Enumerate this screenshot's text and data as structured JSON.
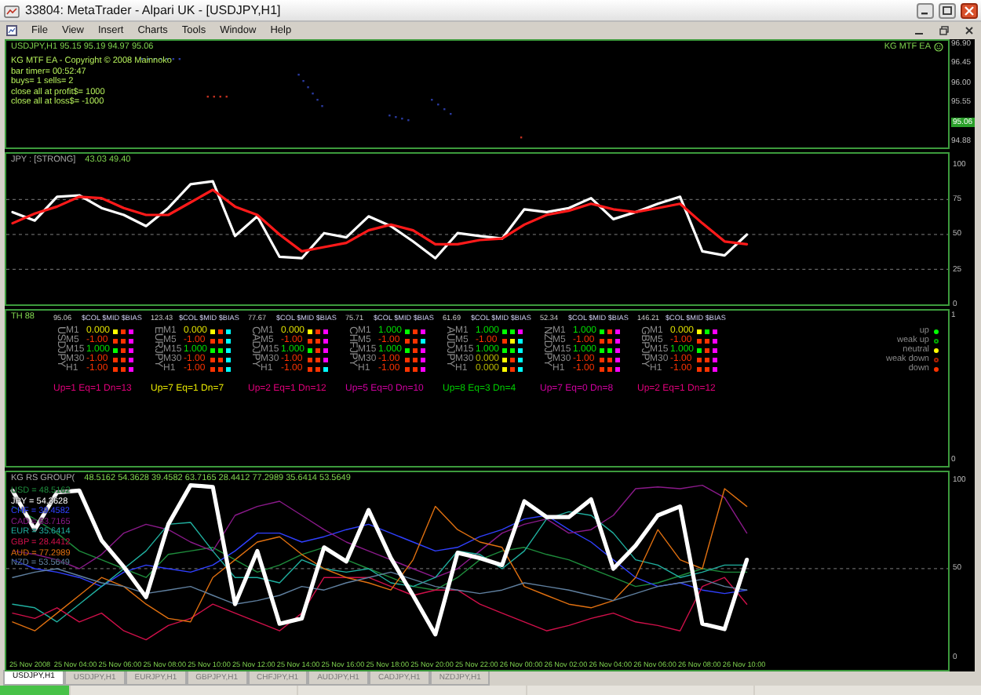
{
  "window": {
    "title": "33804: MetaTrader - Alpari UK - [USDJPY,H1]"
  },
  "menu": [
    "File",
    "View",
    "Insert",
    "Charts",
    "Tools",
    "Window",
    "Help"
  ],
  "price_pane": {
    "symbol_line": "USDJPY,H1  95.15 95.19 94.97 95.06",
    "expert": "KG MTF EA",
    "info_lines": [
      "KG MTF EA - Copyright © 2008 Mainnoko",
      "bar timer= 00:52:47",
      "buys= 1    sells= 2",
      "close all at profit$= 1000",
      "close all at loss$= -1000"
    ],
    "axis_labels": [
      {
        "text": "96.90",
        "current": false
      },
      {
        "text": "96.45",
        "current": false
      },
      {
        "text": "96.00",
        "current": false
      },
      {
        "text": "95.55",
        "current": false
      },
      {
        "text": "95.06",
        "current": true
      },
      {
        "text": "94.88",
        "current": false
      }
    ]
  },
  "strength_pane": {
    "title": "JPY : [STRONG]",
    "values": "43.03 49.40",
    "chart_data": {
      "type": "line",
      "ylim": [
        0,
        107.8
      ],
      "yticks": [
        0,
        25,
        50,
        75,
        100
      ],
      "grid": true,
      "series": [
        {
          "color": "#ffffff",
          "values": [
            66,
            60,
            77,
            78,
            69,
            64,
            56,
            69,
            86,
            88,
            49,
            63,
            34,
            33,
            51,
            48,
            63,
            56,
            45,
            33,
            51,
            49,
            47,
            68,
            66,
            69,
            76,
            61,
            66,
            72,
            77,
            38,
            35,
            50
          ]
        },
        {
          "color": "#ff1a1a",
          "values": [
            58,
            65,
            70,
            77,
            76,
            69,
            64,
            64,
            73,
            82,
            70,
            64,
            50,
            38,
            41,
            44,
            53,
            57,
            53,
            43,
            43,
            46,
            47,
            57,
            64,
            67,
            72,
            68,
            66,
            69,
            72,
            58,
            45,
            43
          ]
        }
      ]
    }
  },
  "matrix_pane": {
    "title": "TH 88",
    "axis_labels": [
      "1",
      "0"
    ],
    "pairs": [
      {
        "name": "USDJPY",
        "price": "95.06",
        "header": "$COL $MID $BIAS",
        "summary": "Up=1 Eq=1 Dn=13",
        "color": "#e0007a",
        "rows": [
          {
            "tf": "M1",
            "value": "0.000",
            "color": "#e0e000",
            "dots": [
              {
                "color": "#ffff00"
              },
              {
                "color": "#ff3300"
              },
              {
                "color": "#ff00ff"
              }
            ]
          },
          {
            "tf": "M5",
            "value": "-1.00",
            "color": "#ff3300",
            "dots": [
              {
                "color": "#ff3300"
              },
              {
                "color": "#ff3300"
              },
              {
                "color": "#ff00ff"
              }
            ]
          },
          {
            "tf": "M15",
            "value": "1.000",
            "color": "#00e000",
            "dots": [
              {
                "color": "#00ff00"
              },
              {
                "color": "#ff3300"
              },
              {
                "color": "#ff00ff"
              }
            ]
          },
          {
            "tf": "M30",
            "value": "-1.00",
            "color": "#ff3300",
            "dots": [
              {
                "color": "#ff3300"
              },
              {
                "color": "#ff3300"
              },
              {
                "color": "#ff00ff"
              }
            ]
          },
          {
            "tf": "H1",
            "value": "-1.00",
            "color": "#ff3300",
            "dots": [
              {
                "color": "#ff3300"
              },
              {
                "color": "#ff3300"
              },
              {
                "color": "#ff00ff"
              }
            ]
          }
        ]
      },
      {
        "name": "EURJPY",
        "price": "123.43",
        "header": "$COL $MID $BIAS",
        "summary": "Up=7 Eq=1 Dn=7",
        "color": "#e8e800",
        "rows": [
          {
            "tf": "M1",
            "value": "0.000",
            "color": "#e0e000",
            "dots": [
              {
                "color": "#ffff00"
              },
              {
                "color": "#ff3300"
              },
              {
                "color": "#00ffff"
              }
            ]
          },
          {
            "tf": "M5",
            "value": "-1.00",
            "color": "#ff3300",
            "dots": [
              {
                "color": "#ff3300"
              },
              {
                "color": "#ff3300"
              },
              {
                "color": "#00ffff"
              }
            ]
          },
          {
            "tf": "M15",
            "value": "1.000",
            "color": "#00e000",
            "dots": [
              {
                "color": "#00ff00"
              },
              {
                "color": "#00ff00"
              },
              {
                "color": "#00ffff"
              }
            ]
          },
          {
            "tf": "M30",
            "value": "-1.00",
            "color": "#ff3300",
            "dots": [
              {
                "color": "#ff3300"
              },
              {
                "color": "#ff3300"
              },
              {
                "color": "#00ffff"
              }
            ]
          },
          {
            "tf": "H1",
            "value": "-1.00",
            "color": "#ff3300",
            "dots": [
              {
                "color": "#ff3300"
              },
              {
                "color": "#ff3300"
              },
              {
                "color": "#00ffff"
              }
            ]
          }
        ]
      },
      {
        "name": "CADJPY",
        "price": "77.67",
        "header": "$COL $MID $BIAS",
        "summary": "Up=2 Eq=1 Dn=12",
        "color": "#e0007a",
        "rows": [
          {
            "tf": "M1",
            "value": "0.000",
            "color": "#e0e000",
            "dots": [
              {
                "color": "#ffff00"
              },
              {
                "color": "#ff3300"
              },
              {
                "color": "#ff00ff"
              }
            ]
          },
          {
            "tf": "M5",
            "value": "-1.00",
            "color": "#ff3300",
            "dots": [
              {
                "color": "#ff3300"
              },
              {
                "color": "#ff3300"
              },
              {
                "color": "#ff00ff"
              }
            ]
          },
          {
            "tf": "M15",
            "value": "1.000",
            "color": "#00e000",
            "dots": [
              {
                "color": "#00ff00"
              },
              {
                "color": "#ff3300"
              },
              {
                "color": "#ff00ff"
              }
            ]
          },
          {
            "tf": "M30",
            "value": "-1.00",
            "color": "#ff3300",
            "dots": [
              {
                "color": "#ff3300"
              },
              {
                "color": "#ff3300"
              },
              {
                "color": "#ff00ff"
              }
            ]
          },
          {
            "tf": "H1",
            "value": "-1.00",
            "color": "#ff3300",
            "dots": [
              {
                "color": "#ff3300"
              },
              {
                "color": "#ff3300"
              },
              {
                "color": "#00ffff"
              }
            ]
          }
        ]
      },
      {
        "name": "CHFJPY",
        "price": "75.71",
        "header": "$COL $MID $BIAS",
        "summary": "Up=5 Eq=0 Dn=10",
        "color": "#d000a0",
        "rows": [
          {
            "tf": "M1",
            "value": "1.000",
            "color": "#00e000",
            "dots": [
              {
                "color": "#00ff00"
              },
              {
                "color": "#ff3300"
              },
              {
                "color": "#ff00ff"
              }
            ]
          },
          {
            "tf": "M5",
            "value": "-1.00",
            "color": "#ff3300",
            "dots": [
              {
                "color": "#ff3300"
              },
              {
                "color": "#ff3300"
              },
              {
                "color": "#00ffff"
              }
            ]
          },
          {
            "tf": "M15",
            "value": "1.000",
            "color": "#00e000",
            "dots": [
              {
                "color": "#00ff00"
              },
              {
                "color": "#ff3300"
              },
              {
                "color": "#ff00ff"
              }
            ]
          },
          {
            "tf": "M30",
            "value": "-1.00",
            "color": "#ff3300",
            "dots": [
              {
                "color": "#ff3300"
              },
              {
                "color": "#ff3300"
              },
              {
                "color": "#ff00ff"
              }
            ]
          },
          {
            "tf": "H1",
            "value": "-1.00",
            "color": "#ff3300",
            "dots": [
              {
                "color": "#ff3300"
              },
              {
                "color": "#ff3300"
              },
              {
                "color": "#ff00ff"
              }
            ]
          }
        ]
      },
      {
        "name": "AUDJPY",
        "price": "61.69",
        "header": "$COL $MID $BIAS",
        "summary": "Up=8 Eq=3 Dn=4",
        "color": "#00cc00",
        "rows": [
          {
            "tf": "M1",
            "value": "1.000",
            "color": "#00e000",
            "dots": [
              {
                "color": "#00ff00"
              },
              {
                "color": "#00ff00"
              },
              {
                "color": "#ff00ff"
              }
            ]
          },
          {
            "tf": "M5",
            "value": "-1.00",
            "color": "#ff3300",
            "dots": [
              {
                "color": "#ff3300"
              },
              {
                "color": "#ffff00"
              },
              {
                "color": "#00ffff"
              }
            ]
          },
          {
            "tf": "M15",
            "value": "1.000",
            "color": "#00e000",
            "dots": [
              {
                "color": "#00ff00"
              },
              {
                "color": "#00ff00"
              },
              {
                "color": "#00ffff"
              }
            ]
          },
          {
            "tf": "M30",
            "value": "0.000",
            "color": "#b8b800",
            "dots": [
              {
                "color": "#ffff00"
              },
              {
                "color": "#ff3300"
              },
              {
                "color": "#00ffff"
              }
            ]
          },
          {
            "tf": "H1",
            "value": "0.000",
            "color": "#b8b800",
            "dots": [
              {
                "color": "#ffff00"
              },
              {
                "color": "#ff3300"
              },
              {
                "color": "#00ffff"
              }
            ]
          }
        ]
      },
      {
        "name": "NZDJPY",
        "price": "52.34",
        "header": "$COL $MID $BIAS",
        "summary": "Up=7 Eq=0 Dn=8",
        "color": "#d000a0",
        "rows": [
          {
            "tf": "M1",
            "value": "1.000",
            "color": "#00e000",
            "dots": [
              {
                "color": "#00ff00"
              },
              {
                "color": "#ff3300"
              },
              {
                "color": "#ff00ff"
              }
            ]
          },
          {
            "tf": "M5",
            "value": "-1.00",
            "color": "#ff3300",
            "dots": [
              {
                "color": "#ff3300"
              },
              {
                "color": "#ff3300"
              },
              {
                "color": "#ff00ff"
              }
            ]
          },
          {
            "tf": "M15",
            "value": "1.000",
            "color": "#00e000",
            "dots": [
              {
                "color": "#00ff00"
              },
              {
                "color": "#00ff00"
              },
              {
                "color": "#ff00ff"
              }
            ]
          },
          {
            "tf": "M30",
            "value": "-1.00",
            "color": "#ff3300",
            "dots": [
              {
                "color": "#ff3300"
              },
              {
                "color": "#ff3300"
              },
              {
                "color": "#ff00ff"
              }
            ]
          },
          {
            "tf": "H1",
            "value": "-1.00",
            "color": "#ff3300",
            "dots": [
              {
                "color": "#ff3300"
              },
              {
                "color": "#ff3300"
              },
              {
                "color": "#ff00ff"
              }
            ]
          }
        ]
      },
      {
        "name": "GBPJPY",
        "price": "146.21",
        "header": "$COL $MID $BIAS",
        "summary": "Up=2 Eq=1 Dn=12",
        "color": "#e0007a",
        "rows": [
          {
            "tf": "M1",
            "value": "0.000",
            "color": "#e0e000",
            "dots": [
              {
                "color": "#ffff00"
              },
              {
                "color": "#00ff00"
              },
              {
                "color": "#ff00ff"
              }
            ]
          },
          {
            "tf": "M5",
            "value": "-1.00",
            "color": "#ff3300",
            "dots": [
              {
                "color": "#ff3300"
              },
              {
                "color": "#ff3300"
              },
              {
                "color": "#ff00ff"
              }
            ]
          },
          {
            "tf": "M15",
            "value": "1.000",
            "color": "#00e000",
            "dots": [
              {
                "color": "#00ff00"
              },
              {
                "color": "#ff3300"
              },
              {
                "color": "#ff00ff"
              }
            ]
          },
          {
            "tf": "M30",
            "value": "-1.00",
            "color": "#ff3300",
            "dots": [
              {
                "color": "#ff3300"
              },
              {
                "color": "#ff3300"
              },
              {
                "color": "#ff00ff"
              }
            ]
          },
          {
            "tf": "H1",
            "value": "-1.00",
            "color": "#ff3300",
            "dots": [
              {
                "color": "#ff3300"
              },
              {
                "color": "#ff3300"
              },
              {
                "color": "#ff00ff"
              }
            ]
          }
        ]
      }
    ],
    "legend": [
      {
        "label": "up",
        "kind": "solid",
        "color": "#00ff00"
      },
      {
        "label": "weak up",
        "kind": "hollow",
        "color": "#00aa00"
      },
      {
        "label": "neutral",
        "kind": "solid",
        "color": "#ffff00"
      },
      {
        "label": "weak down",
        "kind": "hollow",
        "color": "#b02000"
      },
      {
        "label": "down",
        "kind": "solid",
        "color": "#ff3300"
      }
    ]
  },
  "rs_pane": {
    "title": "KG RS GROUP(",
    "values": "48.5162 54.3628 39.4582 63.7165 28.4412 77.2989 35.6414 53.5649",
    "legend": [
      {
        "label": "USD = 48.5162",
        "color": "#1e8c3c"
      },
      {
        "label": "JPY = 54.3628",
        "color": "#ffffff"
      },
      {
        "label": "CHF = 39.4582",
        "color": "#3040ff"
      },
      {
        "label": "CAD = 63.7165",
        "color": "#8a1a8a"
      },
      {
        "label": "EUR = 35.6414",
        "color": "#20b0a0"
      },
      {
        "label": "GBP = 28.4412",
        "color": "#d0104a"
      },
      {
        "label": "AUD = 77.2989",
        "color": "#e07010"
      },
      {
        "label": "NZD = 53.5649",
        "color": "#6080a0"
      }
    ],
    "time_labels": [
      "25 Nov 2008",
      "25 Nov 04:00",
      "25 Nov 06:00",
      "25 Nov 08:00",
      "25 Nov 10:00",
      "25 Nov 12:00",
      "25 Nov 14:00",
      "25 Nov 16:00",
      "25 Nov 18:00",
      "25 Nov 20:00",
      "25 Nov 22:00",
      "26 Nov 00:00",
      "26 Nov 02:00",
      "26 Nov 04:00",
      "26 Nov 06:00",
      "26 Nov 08:00",
      "26 Nov 10:00"
    ],
    "chart_data": {
      "type": "line",
      "ylim": [
        -7,
        104.3
      ],
      "yticks": [
        0,
        50,
        100
      ],
      "grid": true,
      "series": [
        {
          "color": "#1e8c3c",
          "values": [
            85,
            78,
            70,
            60,
            55,
            50,
            45,
            58,
            60,
            62,
            55,
            48,
            52,
            58,
            62,
            55,
            50,
            45,
            40,
            38,
            45,
            55,
            60,
            62,
            58,
            55,
            50,
            45,
            40,
            42,
            46,
            50,
            48,
            48
          ]
        },
        {
          "color": "#3040ff",
          "values": [
            55,
            50,
            48,
            45,
            40,
            48,
            52,
            50,
            48,
            52,
            60,
            70,
            70,
            65,
            68,
            72,
            75,
            70,
            65,
            60,
            62,
            68,
            72,
            78,
            80,
            72,
            65,
            55,
            45,
            40,
            42,
            38,
            36,
            38
          ]
        },
        {
          "color": "#8a1a8a",
          "values": [
            60,
            58,
            55,
            50,
            58,
            70,
            75,
            72,
            65,
            60,
            80,
            85,
            88,
            80,
            72,
            65,
            60,
            55,
            50,
            45,
            50,
            60,
            70,
            75,
            78,
            70,
            72,
            80,
            95,
            96,
            95,
            97,
            90,
            70
          ]
        },
        {
          "color": "#20b0a0",
          "values": [
            30,
            28,
            20,
            30,
            40,
            50,
            60,
            75,
            76,
            60,
            45,
            45,
            42,
            55,
            50,
            48,
            50,
            42,
            40,
            45,
            60,
            58,
            50,
            60,
            78,
            82,
            80,
            70,
            55,
            52,
            45,
            48,
            52,
            52
          ]
        },
        {
          "color": "#d0104a",
          "values": [
            25,
            22,
            28,
            20,
            25,
            15,
            10,
            18,
            22,
            30,
            25,
            20,
            15,
            25,
            45,
            45,
            45,
            40,
            35,
            38,
            38,
            30,
            25,
            20,
            15,
            18,
            22,
            25,
            20,
            18,
            15,
            40,
            45,
            30
          ]
        },
        {
          "color": "#e07010",
          "values": [
            20,
            15,
            25,
            35,
            45,
            40,
            30,
            22,
            20,
            45,
            55,
            65,
            68,
            58,
            50,
            45,
            42,
            38,
            55,
            85,
            72,
            65,
            62,
            40,
            35,
            30,
            28,
            32,
            45,
            72,
            55,
            50,
            95,
            85
          ]
        },
        {
          "color": "#6080a0",
          "values": [
            45,
            48,
            50,
            46,
            42,
            40,
            36,
            38,
            40,
            35,
            30,
            32,
            35,
            40,
            38,
            42,
            45,
            48,
            44,
            40,
            38,
            36,
            38,
            42,
            40,
            38,
            35,
            32,
            36,
            40,
            42,
            44,
            40,
            38
          ]
        },
        {
          "color": "#ffffff",
          "values": [
            94,
            72,
            93,
            94,
            66,
            51,
            34,
            75,
            97,
            96,
            30,
            60,
            19,
            22,
            62,
            54,
            83,
            56,
            35,
            13,
            59,
            56,
            52,
            88,
            79,
            79,
            89,
            50,
            63,
            80,
            85,
            19,
            16,
            55
          ]
        }
      ]
    }
  },
  "tabs": [
    {
      "label": "USDJPY,H1",
      "selected": true
    },
    {
      "label": "USDJPY,H1",
      "selected": false
    },
    {
      "label": "EURJPY,H1",
      "selected": false
    },
    {
      "label": "GBPJPY,H1",
      "selected": false
    },
    {
      "label": "CHFJPY,H1",
      "selected": false
    },
    {
      "label": "AUDJPY,H1",
      "selected": false
    },
    {
      "label": "CADJPY,H1",
      "selected": false
    },
    {
      "label": "NZDJPY,H1",
      "selected": false
    }
  ]
}
